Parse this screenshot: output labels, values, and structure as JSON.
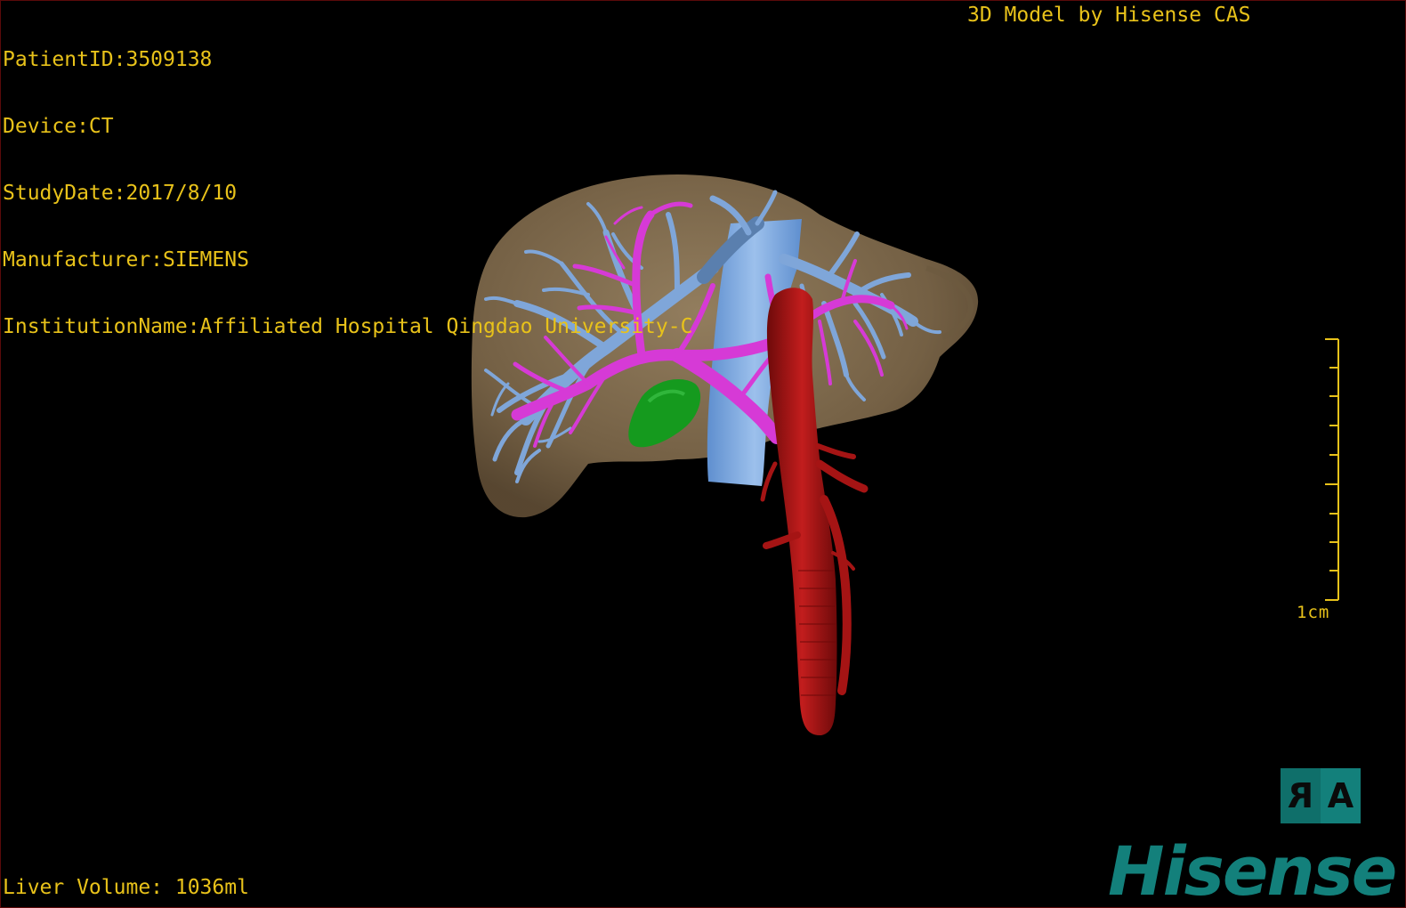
{
  "overlay": {
    "patient_id": "PatientID:3509138",
    "device": "Device:CT",
    "study_date": "StudyDate:2017/8/10",
    "manufacturer": "Manufacturer:SIEMENS",
    "institution": "InstitutionName:Affiliated Hospital Qingdao University-C",
    "credit": "3D Model by Hisense CAS",
    "liver_volume": "Liver Volume: 1036ml"
  },
  "scale_bar": {
    "label": "1cm"
  },
  "orientation": {
    "right": "R",
    "anterior": "A"
  },
  "brand": {
    "logo_text": "Hisense"
  },
  "colors": {
    "overlay_text": "#e8c21a",
    "liver": "#8a7556",
    "portal_vein": "#7fa6d9",
    "hepatic_artery": "#d63ad6",
    "aorta": "#a51414",
    "gallbladder": "#159a1e",
    "brand": "#13807b"
  },
  "icons": {
    "orientation_cube": "orientation-cube-icon",
    "logo": "hisense-logo"
  }
}
